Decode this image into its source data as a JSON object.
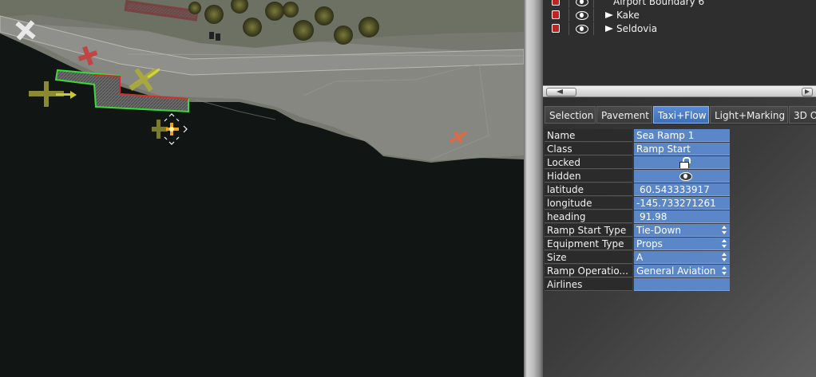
{
  "layers": [
    {
      "label": "Airport Boundary 6",
      "expandable": false
    },
    {
      "label": "Kake",
      "expandable": true
    },
    {
      "label": "Seldovia",
      "expandable": true
    }
  ],
  "tabs": [
    "Selection",
    "Pavement",
    "Taxi+Flow",
    "Light+Marking",
    "3D O"
  ],
  "active_tab": "Taxi+Flow",
  "properties": {
    "name": {
      "label": "Name",
      "value": "Sea Ramp 1"
    },
    "class": {
      "label": "Class",
      "value": "Ramp Start"
    },
    "locked": {
      "label": "Locked",
      "icon": "unlocked-padlock-icon"
    },
    "hidden": {
      "label": "Hidden",
      "icon": "eye-icon"
    },
    "latitude": {
      "label": "latitude",
      "value": "60.543333917"
    },
    "longitude": {
      "label": "longitude",
      "value": "-145.733271261"
    },
    "heading": {
      "label": "heading",
      "value": "91.98"
    },
    "ramp_start_type": {
      "label": "Ramp Start Type",
      "value": "Tie-Down"
    },
    "equipment_type": {
      "label": "Equipment Type",
      "value": "Props"
    },
    "size": {
      "label": "Size",
      "value": "A"
    },
    "ramp_operation": {
      "label": "Ramp Operatio...",
      "value": "General Aviation"
    },
    "airlines": {
      "label": "Airlines",
      "value": ""
    }
  },
  "colors": {
    "selection_blue": "#5b87c9",
    "active_tab": "#4a7fcc",
    "lock_red": "#c12222",
    "selected_outline": "#3bd93b",
    "edge_red": "#d42a2a"
  }
}
